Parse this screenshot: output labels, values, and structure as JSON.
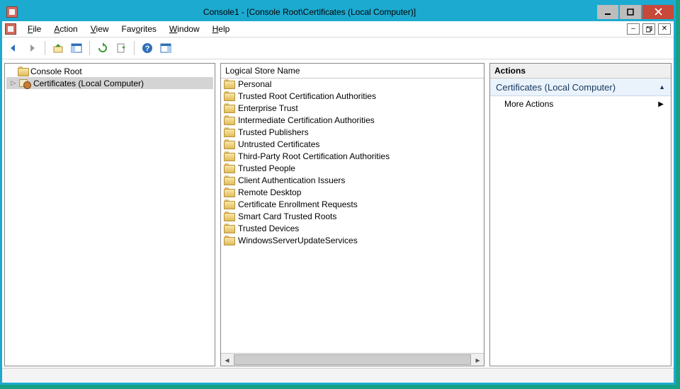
{
  "title": "Console1 - [Console Root\\Certificates (Local Computer)]",
  "menu": {
    "file": "File",
    "action": "Action",
    "view": "View",
    "favorites": "Favorites",
    "window": "Window",
    "help": "Help"
  },
  "tree": {
    "root_label": "Console Root",
    "child_label": "Certificates (Local Computer)"
  },
  "list": {
    "column_header": "Logical Store Name",
    "items": [
      "Personal",
      "Trusted Root Certification Authorities",
      "Enterprise Trust",
      "Intermediate Certification Authorities",
      "Trusted Publishers",
      "Untrusted Certificates",
      "Third-Party Root Certification Authorities",
      "Trusted People",
      "Client Authentication Issuers",
      "Remote Desktop",
      "Certificate Enrollment Requests",
      "Smart Card Trusted Roots",
      "Trusted Devices",
      "WindowsServerUpdateServices"
    ]
  },
  "actions": {
    "header": "Actions",
    "group_label": "Certificates (Local Computer)",
    "more_actions": "More Actions"
  }
}
